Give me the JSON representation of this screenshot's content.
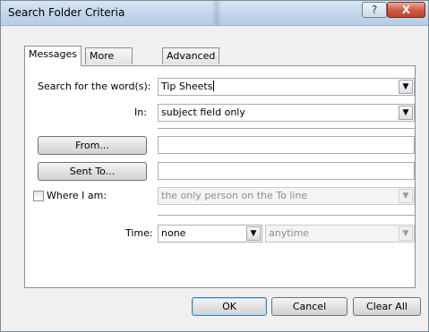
{
  "window": {
    "title": "Search Folder Criteria",
    "help_glyph": "?",
    "close_glyph": "X"
  },
  "tabs": [
    {
      "label": "Messages",
      "active": true
    },
    {
      "label": "More Choices",
      "active": false
    },
    {
      "label": "Advanced",
      "active": false
    }
  ],
  "search": {
    "label": "Search for the word(s):",
    "value": "Tip Sheets"
  },
  "in": {
    "label": "In:",
    "value": "subject field only"
  },
  "from_button": "From...",
  "sentto_button": "Sent To...",
  "where": {
    "label": "Where I am:",
    "checked": false,
    "value": "the only person on the To line"
  },
  "time": {
    "label": "Time:",
    "value": "none",
    "range_value": "anytime"
  },
  "footer": {
    "ok": "OK",
    "cancel": "Cancel",
    "clear_all": "Clear All"
  },
  "colors": {
    "titlebar": "#c2d5ea",
    "close": "#c0412a",
    "dialog_bg": "#f0f0f0"
  },
  "icons": {
    "dropdown": "chevron-down-icon",
    "help": "help-icon",
    "close": "close-icon"
  }
}
